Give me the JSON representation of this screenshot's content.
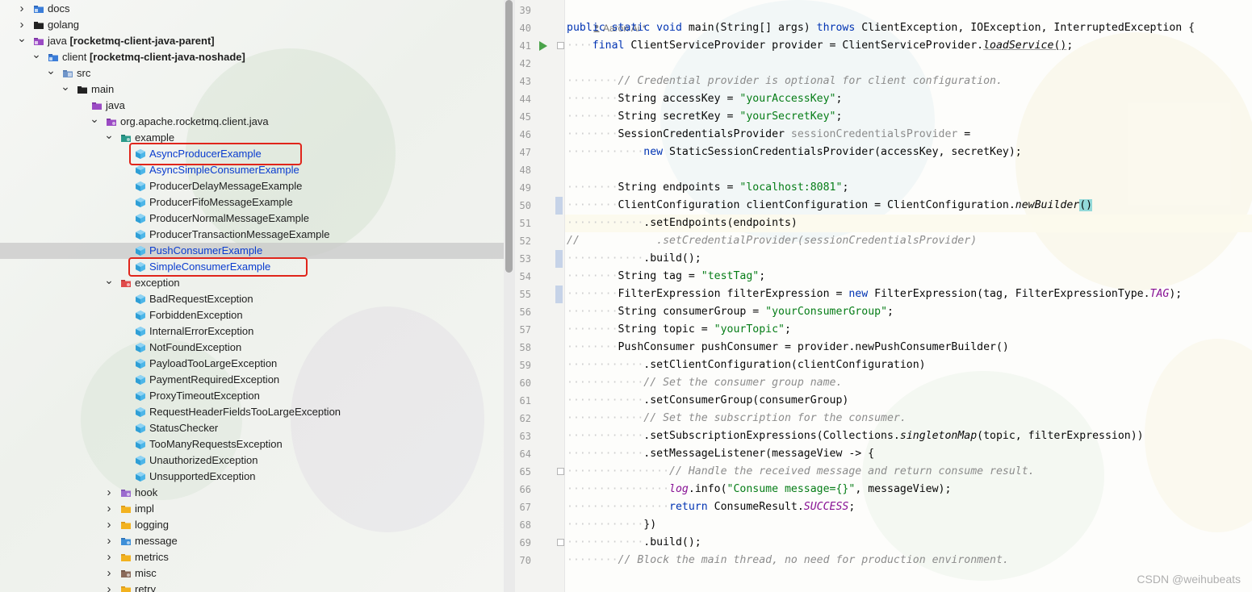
{
  "tree": {
    "items": [
      {
        "label": "docs",
        "suffix": "",
        "indent": 0,
        "chevron": "right",
        "icon": "folder-module-icon",
        "blue": false
      },
      {
        "label": "golang",
        "suffix": "",
        "indent": 0,
        "chevron": "right",
        "icon": "folder-icon",
        "blue": false
      },
      {
        "label": "java",
        "suffix": "[rocketmq-client-java-parent]",
        "indent": 0,
        "chevron": "down",
        "icon": "folder-module-purple-icon",
        "blue": false
      },
      {
        "label": "client",
        "suffix": "[rocketmq-client-java-noshade]",
        "indent": 1,
        "chevron": "down",
        "icon": "folder-module-icon",
        "blue": false
      },
      {
        "label": "src",
        "suffix": "",
        "indent": 2,
        "chevron": "down",
        "icon": "folder-source-icon",
        "blue": false
      },
      {
        "label": "main",
        "suffix": "",
        "indent": 3,
        "chevron": "down",
        "icon": "folder-icon",
        "blue": false
      },
      {
        "label": "java",
        "suffix": "",
        "indent": 4,
        "chevron": "",
        "icon": "folder-source-root-icon",
        "blue": false
      },
      {
        "label": "org.apache.rocketmq.client.java",
        "suffix": "",
        "indent": 5,
        "chevron": "down",
        "icon": "package-icon",
        "blue": false
      },
      {
        "label": "example",
        "suffix": "",
        "indent": 6,
        "chevron": "down",
        "icon": "package-teal-icon",
        "blue": false
      },
      {
        "label": "AsyncProducerExample",
        "suffix": "",
        "indent": 7,
        "chevron": "",
        "icon": "java-class-icon",
        "blue": true
      },
      {
        "label": "AsyncSimpleConsumerExample",
        "suffix": "",
        "indent": 7,
        "chevron": "",
        "icon": "java-class-icon",
        "blue": true
      },
      {
        "label": "ProducerDelayMessageExample",
        "suffix": "",
        "indent": 7,
        "chevron": "",
        "icon": "java-class-icon",
        "blue": false
      },
      {
        "label": "ProducerFifoMessageExample",
        "suffix": "",
        "indent": 7,
        "chevron": "",
        "icon": "java-class-icon",
        "blue": false
      },
      {
        "label": "ProducerNormalMessageExample",
        "suffix": "",
        "indent": 7,
        "chevron": "",
        "icon": "java-class-icon",
        "blue": false
      },
      {
        "label": "ProducerTransactionMessageExample",
        "suffix": "",
        "indent": 7,
        "chevron": "",
        "icon": "java-class-icon",
        "blue": false
      },
      {
        "label": "PushConsumerExample",
        "suffix": "",
        "indent": 7,
        "chevron": "",
        "icon": "java-class-icon",
        "blue": true
      },
      {
        "label": "SimpleConsumerExample",
        "suffix": "",
        "indent": 7,
        "chevron": "",
        "icon": "java-class-icon",
        "blue": true
      },
      {
        "label": "exception",
        "suffix": "",
        "indent": 6,
        "chevron": "down",
        "icon": "package-red-icon",
        "blue": false
      },
      {
        "label": "BadRequestException",
        "suffix": "",
        "indent": 7,
        "chevron": "",
        "icon": "java-class-icon",
        "blue": false
      },
      {
        "label": "ForbiddenException",
        "suffix": "",
        "indent": 7,
        "chevron": "",
        "icon": "java-class-icon",
        "blue": false
      },
      {
        "label": "InternalErrorException",
        "suffix": "",
        "indent": 7,
        "chevron": "",
        "icon": "java-class-icon",
        "blue": false
      },
      {
        "label": "NotFoundException",
        "suffix": "",
        "indent": 7,
        "chevron": "",
        "icon": "java-class-icon",
        "blue": false
      },
      {
        "label": "PayloadTooLargeException",
        "suffix": "",
        "indent": 7,
        "chevron": "",
        "icon": "java-class-icon",
        "blue": false
      },
      {
        "label": "PaymentRequiredException",
        "suffix": "",
        "indent": 7,
        "chevron": "",
        "icon": "java-class-icon",
        "blue": false
      },
      {
        "label": "ProxyTimeoutException",
        "suffix": "",
        "indent": 7,
        "chevron": "",
        "icon": "java-class-icon",
        "blue": false
      },
      {
        "label": "RequestHeaderFieldsTooLargeException",
        "suffix": "",
        "indent": 7,
        "chevron": "",
        "icon": "java-class-icon",
        "blue": false
      },
      {
        "label": "StatusChecker",
        "suffix": "",
        "indent": 7,
        "chevron": "",
        "icon": "java-class-icon",
        "blue": false
      },
      {
        "label": "TooManyRequestsException",
        "suffix": "",
        "indent": 7,
        "chevron": "",
        "icon": "java-class-icon",
        "blue": false
      },
      {
        "label": "UnauthorizedException",
        "suffix": "",
        "indent": 7,
        "chevron": "",
        "icon": "java-class-icon",
        "blue": false
      },
      {
        "label": "UnsupportedException",
        "suffix": "",
        "indent": 7,
        "chevron": "",
        "icon": "java-class-icon",
        "blue": false
      },
      {
        "label": "hook",
        "suffix": "",
        "indent": 6,
        "chevron": "right",
        "icon": "package-purple-icon",
        "blue": false
      },
      {
        "label": "impl",
        "suffix": "",
        "indent": 6,
        "chevron": "right",
        "icon": "folder-yellow-icon",
        "blue": false
      },
      {
        "label": "logging",
        "suffix": "",
        "indent": 6,
        "chevron": "right",
        "icon": "folder-yellow-icon",
        "blue": false
      },
      {
        "label": "message",
        "suffix": "",
        "indent": 6,
        "chevron": "right",
        "icon": "package-blue-icon",
        "blue": false
      },
      {
        "label": "metrics",
        "suffix": "",
        "indent": 6,
        "chevron": "right",
        "icon": "folder-yellow-icon",
        "blue": false
      },
      {
        "label": "misc",
        "suffix": "",
        "indent": 6,
        "chevron": "right",
        "icon": "package-brown-icon",
        "blue": false
      },
      {
        "label": "retry",
        "suffix": "",
        "indent": 6,
        "chevron": "right",
        "icon": "folder-yellow-icon",
        "blue": false
      }
    ],
    "selected_index": 15
  },
  "editor": {
    "author_hint": "Aaron Ai *",
    "lines": [
      {
        "n": "39",
        "html": ""
      },
      {
        "n": "40",
        "html": "<span class='kw'>public static void</span> main(String[] args) <span class='kw'>throws</span> ClientException, IOException, InterruptedException {"
      },
      {
        "n": "41",
        "html": "<span class='dots'>····</span><span class='kw'>final</span> ClientServiceProvider provider = ClientServiceProvider.<span class='ital underline'>loadService</span><span class='underline'>()</span>;"
      },
      {
        "n": "42",
        "html": ""
      },
      {
        "n": "43",
        "html": "<span class='dots'>········</span><span class='cmt'>// Credential provider is optional for client configuration.</span>"
      },
      {
        "n": "44",
        "html": "<span class='dots'>········</span>String accessKey = <span class='str'>\"yourAccessKey\"</span>;"
      },
      {
        "n": "45",
        "html": "<span class='dots'>········</span>String secretKey = <span class='str'>\"yourSecretKey\"</span>;"
      },
      {
        "n": "46",
        "html": "<span class='dots'>········</span>SessionCredentialsProvider <span class='gray'>sessionCredentialsProvider</span> ="
      },
      {
        "n": "47",
        "html": "<span class='dots'>············</span><span class='kw'>new</span> StaticSessionCredentialsProvider(accessKey, secretKey);"
      },
      {
        "n": "48",
        "html": ""
      },
      {
        "n": "49",
        "html": "<span class='dots'>········</span>String endpoints = <span class='str'>\"localhost:8081\"</span>;"
      },
      {
        "n": "50",
        "html": "<span class='dots'>········</span>ClientConfiguration clientConfiguration = ClientConfiguration.<span class='ital'>newBuilder</span><span class='paren-hl'>()</span>"
      },
      {
        "n": "51",
        "html": "<span class='dots'>············</span>.setEndpoints(endpoints)"
      },
      {
        "n": "52",
        "html": "<span class='cmt'>//            .setCredentialProvider(sessionCredentialsProvider)</span>"
      },
      {
        "n": "53",
        "html": "<span class='dots'>············</span>.build();"
      },
      {
        "n": "54",
        "html": "<span class='dots'>········</span>String tag = <span class='str'>\"testTag\"</span>;"
      },
      {
        "n": "55",
        "html": "<span class='dots'>········</span>FilterExpression filterExpression = <span class='kw'>new</span> FilterExpression(tag, FilterExpressionType.<span class='const'>TAG</span>);"
      },
      {
        "n": "56",
        "html": "<span class='dots'>········</span>String consumerGroup = <span class='str'>\"yourConsumerGroup\"</span>;"
      },
      {
        "n": "57",
        "html": "<span class='dots'>········</span>String topic = <span class='str'>\"yourTopic\"</span>;"
      },
      {
        "n": "58",
        "html": "<span class='dots'>········</span>PushConsumer pushConsumer = provider.newPushConsumerBuilder()"
      },
      {
        "n": "59",
        "html": "<span class='dots'>············</span>.setClientConfiguration(clientConfiguration)"
      },
      {
        "n": "60",
        "html": "<span class='dots'>············</span><span class='cmt'>// Set the consumer group name.</span>"
      },
      {
        "n": "61",
        "html": "<span class='dots'>············</span>.setConsumerGroup(consumerGroup)"
      },
      {
        "n": "62",
        "html": "<span class='dots'>············</span><span class='cmt'>// Set the subscription for the consumer.</span>"
      },
      {
        "n": "63",
        "html": "<span class='dots'>············</span>.setSubscriptionExpressions(Collections.<span class='ital'>singletonMap</span>(topic, filterExpression))"
      },
      {
        "n": "64",
        "html": "<span class='dots'>············</span>.setMessageListener(messageView -> {"
      },
      {
        "n": "65",
        "html": "<span class='dots'>················</span><span class='cmt'>// Handle the received message and return consume result.</span>"
      },
      {
        "n": "66",
        "html": "<span class='dots'>················</span><span class='const'>log</span>.info(<span class='str'>\"Consume message={}\"</span>, messageView);"
      },
      {
        "n": "67",
        "html": "<span class='dots'>················</span><span class='kw'>return</span> ConsumeResult.<span class='const'>SUCCESS</span>;"
      },
      {
        "n": "68",
        "html": "<span class='dots'>············</span>})"
      },
      {
        "n": "69",
        "html": "<span class='dots'>············</span>.build();"
      },
      {
        "n": "70",
        "html": "<span class='dots'>········</span><span class='cmt'>// Block the main thread, no need for production environment.</span>"
      }
    ],
    "current_line": "50"
  },
  "watermark": "CSDN @weihubeats"
}
